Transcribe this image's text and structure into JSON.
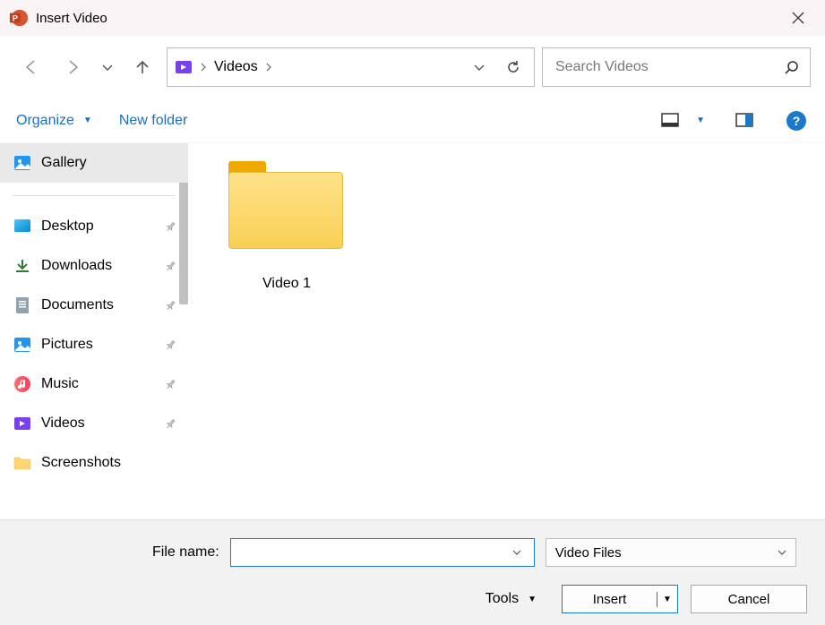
{
  "title": "Insert Video",
  "path": {
    "folder": "Videos"
  },
  "search": {
    "placeholder": "Search Videos"
  },
  "toolbar": {
    "organize": "Organize",
    "newfolder": "New folder"
  },
  "sidebar": {
    "gallery": "Gallery",
    "desktop": "Desktop",
    "downloads": "Downloads",
    "documents": "Documents",
    "pictures": "Pictures",
    "music": "Music",
    "videos": "Videos",
    "screenshots": "Screenshots"
  },
  "content": {
    "items": [
      {
        "name": "Video 1",
        "type": "folder"
      }
    ]
  },
  "bottom": {
    "label": "File name:",
    "filename": "",
    "filter": "Video Files",
    "tools": "Tools",
    "insert": "Insert",
    "cancel": "Cancel"
  }
}
